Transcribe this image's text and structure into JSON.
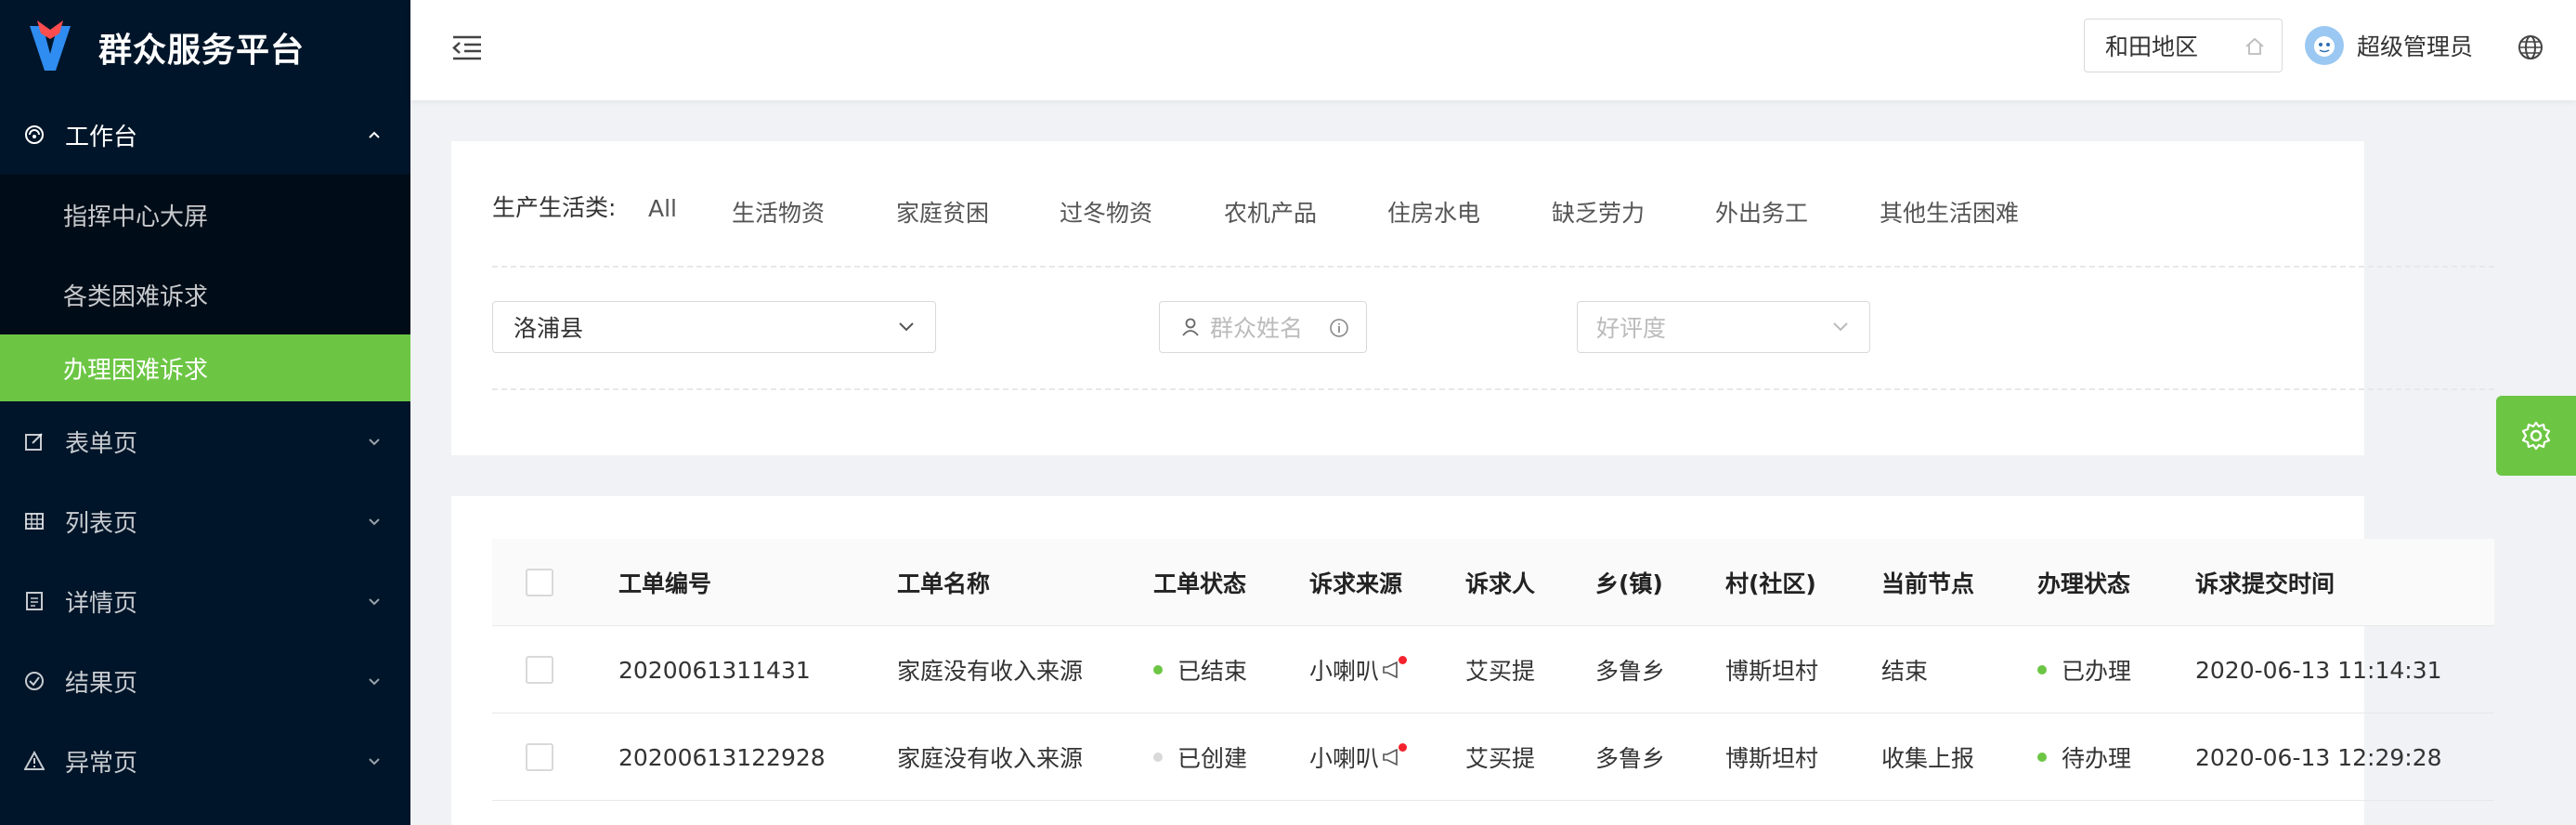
{
  "app": {
    "title": "群众服务平台",
    "accent": "#6cc644",
    "sidebar_bg": "#001529"
  },
  "sidebar": {
    "workbench": "工作台",
    "sub_items": [
      "指挥中心大屏",
      "各类困难诉求",
      "办理困难诉求"
    ],
    "menus": [
      "表单页",
      "列表页",
      "详情页",
      "结果页",
      "异常页"
    ]
  },
  "header": {
    "region": "和田地区",
    "user": "超级管理员"
  },
  "filters": {
    "category_label": "生产生活类:",
    "categories": [
      "All",
      "生活物资",
      "家庭贫困",
      "过冬物资",
      "农机产品",
      "住房水电",
      "缺乏劳力",
      "外出务工",
      "其他生活困难"
    ],
    "county": "洛浦县",
    "name_placeholder": "群众姓名",
    "rating_placeholder": "好评度"
  },
  "table": {
    "headers": [
      "工单编号",
      "工单名称",
      "工单状态",
      "诉求来源",
      "诉求人",
      "乡(镇)",
      "村(社区)",
      "当前节点",
      "办理状态",
      "诉求提交时间"
    ],
    "rows": [
      {
        "id": "2020061311431",
        "name": "家庭没有收入来源",
        "status": "已结束",
        "status_color": "#6cc644",
        "source": "小喇叭",
        "requester": "艾买提",
        "town": "多鲁乡",
        "village": "博斯坦村",
        "node": "结束",
        "handle_status": "已办理",
        "handle_color": "#6cc644",
        "time": "2020-06-13 11:14:31"
      },
      {
        "id": "2020061312292​8",
        "name": "家庭没有收入来源",
        "status": "已创建",
        "status_color": "#d9d9d9",
        "source": "小喇叭",
        "requester": "艾买提",
        "town": "多鲁乡",
        "village": "博斯坦村",
        "node": "收集上报",
        "handle_status": "待办理",
        "handle_color": "#6cc644",
        "time": "2020-06-13 12:29:28"
      }
    ]
  }
}
